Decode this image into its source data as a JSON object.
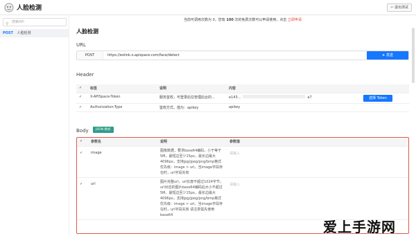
{
  "app": {
    "title": "人脸检测",
    "exit_label": "退出测试"
  },
  "sidebar": {
    "search_placeholder": "搜索API",
    "item_method": "POST",
    "item_label": "人脸检测"
  },
  "notice": {
    "prefix": "当前可调用次数为 0，您有 ",
    "count": "100",
    "suffix": " 次的免费次数可以申请使用，点击 ",
    "link": "立即申请"
  },
  "main": {
    "title": "人脸检测",
    "url_section": "URL",
    "method": "POST",
    "url": "https://eolink.o.apispace.com/face/detect",
    "send_label": "发送",
    "header_section": "Header",
    "header_cols": [
      "标签",
      "说明",
      "内容"
    ],
    "header_rows": [
      {
        "name": "X-APISpace-Token",
        "desc": "服务鉴权，可登录后在管理后台的...",
        "value": "e143...",
        "value_end": "a7",
        "action": "选择 Token"
      },
      {
        "name": "Authorization-Type",
        "desc": "鉴权方式，值为：apikey",
        "value": "apikey",
        "value_end": "",
        "action": ""
      }
    ],
    "body_section": "Body",
    "body_badge": "JSON 格式",
    "body_cols": [
      "参数名",
      "说明",
      "参数值"
    ],
    "body_rows": [
      {
        "name": "image",
        "desc": "图像数据，要求base64编码，小于等于5M，最短边至少15px，最长边最大4096px，支持jpg/jpeg/png/bmp格式 优先级：image > url，当image字段存在时，url字段失效",
        "value_placeholder": "请输入"
      },
      {
        "name": "url",
        "desc": "图片完整url，url长度不超过1024字节，url对应的图片base64编码后大小不超过5M，最短边至少15px，最长边最大4096px，支持jpg/jpeg/png/bmp格式 优先级：image > url，当image字段存在时，url字段失效 请注意需先使用 base64",
        "value_placeholder": "请输入"
      }
    ]
  },
  "watermark": "爱上手游网"
}
